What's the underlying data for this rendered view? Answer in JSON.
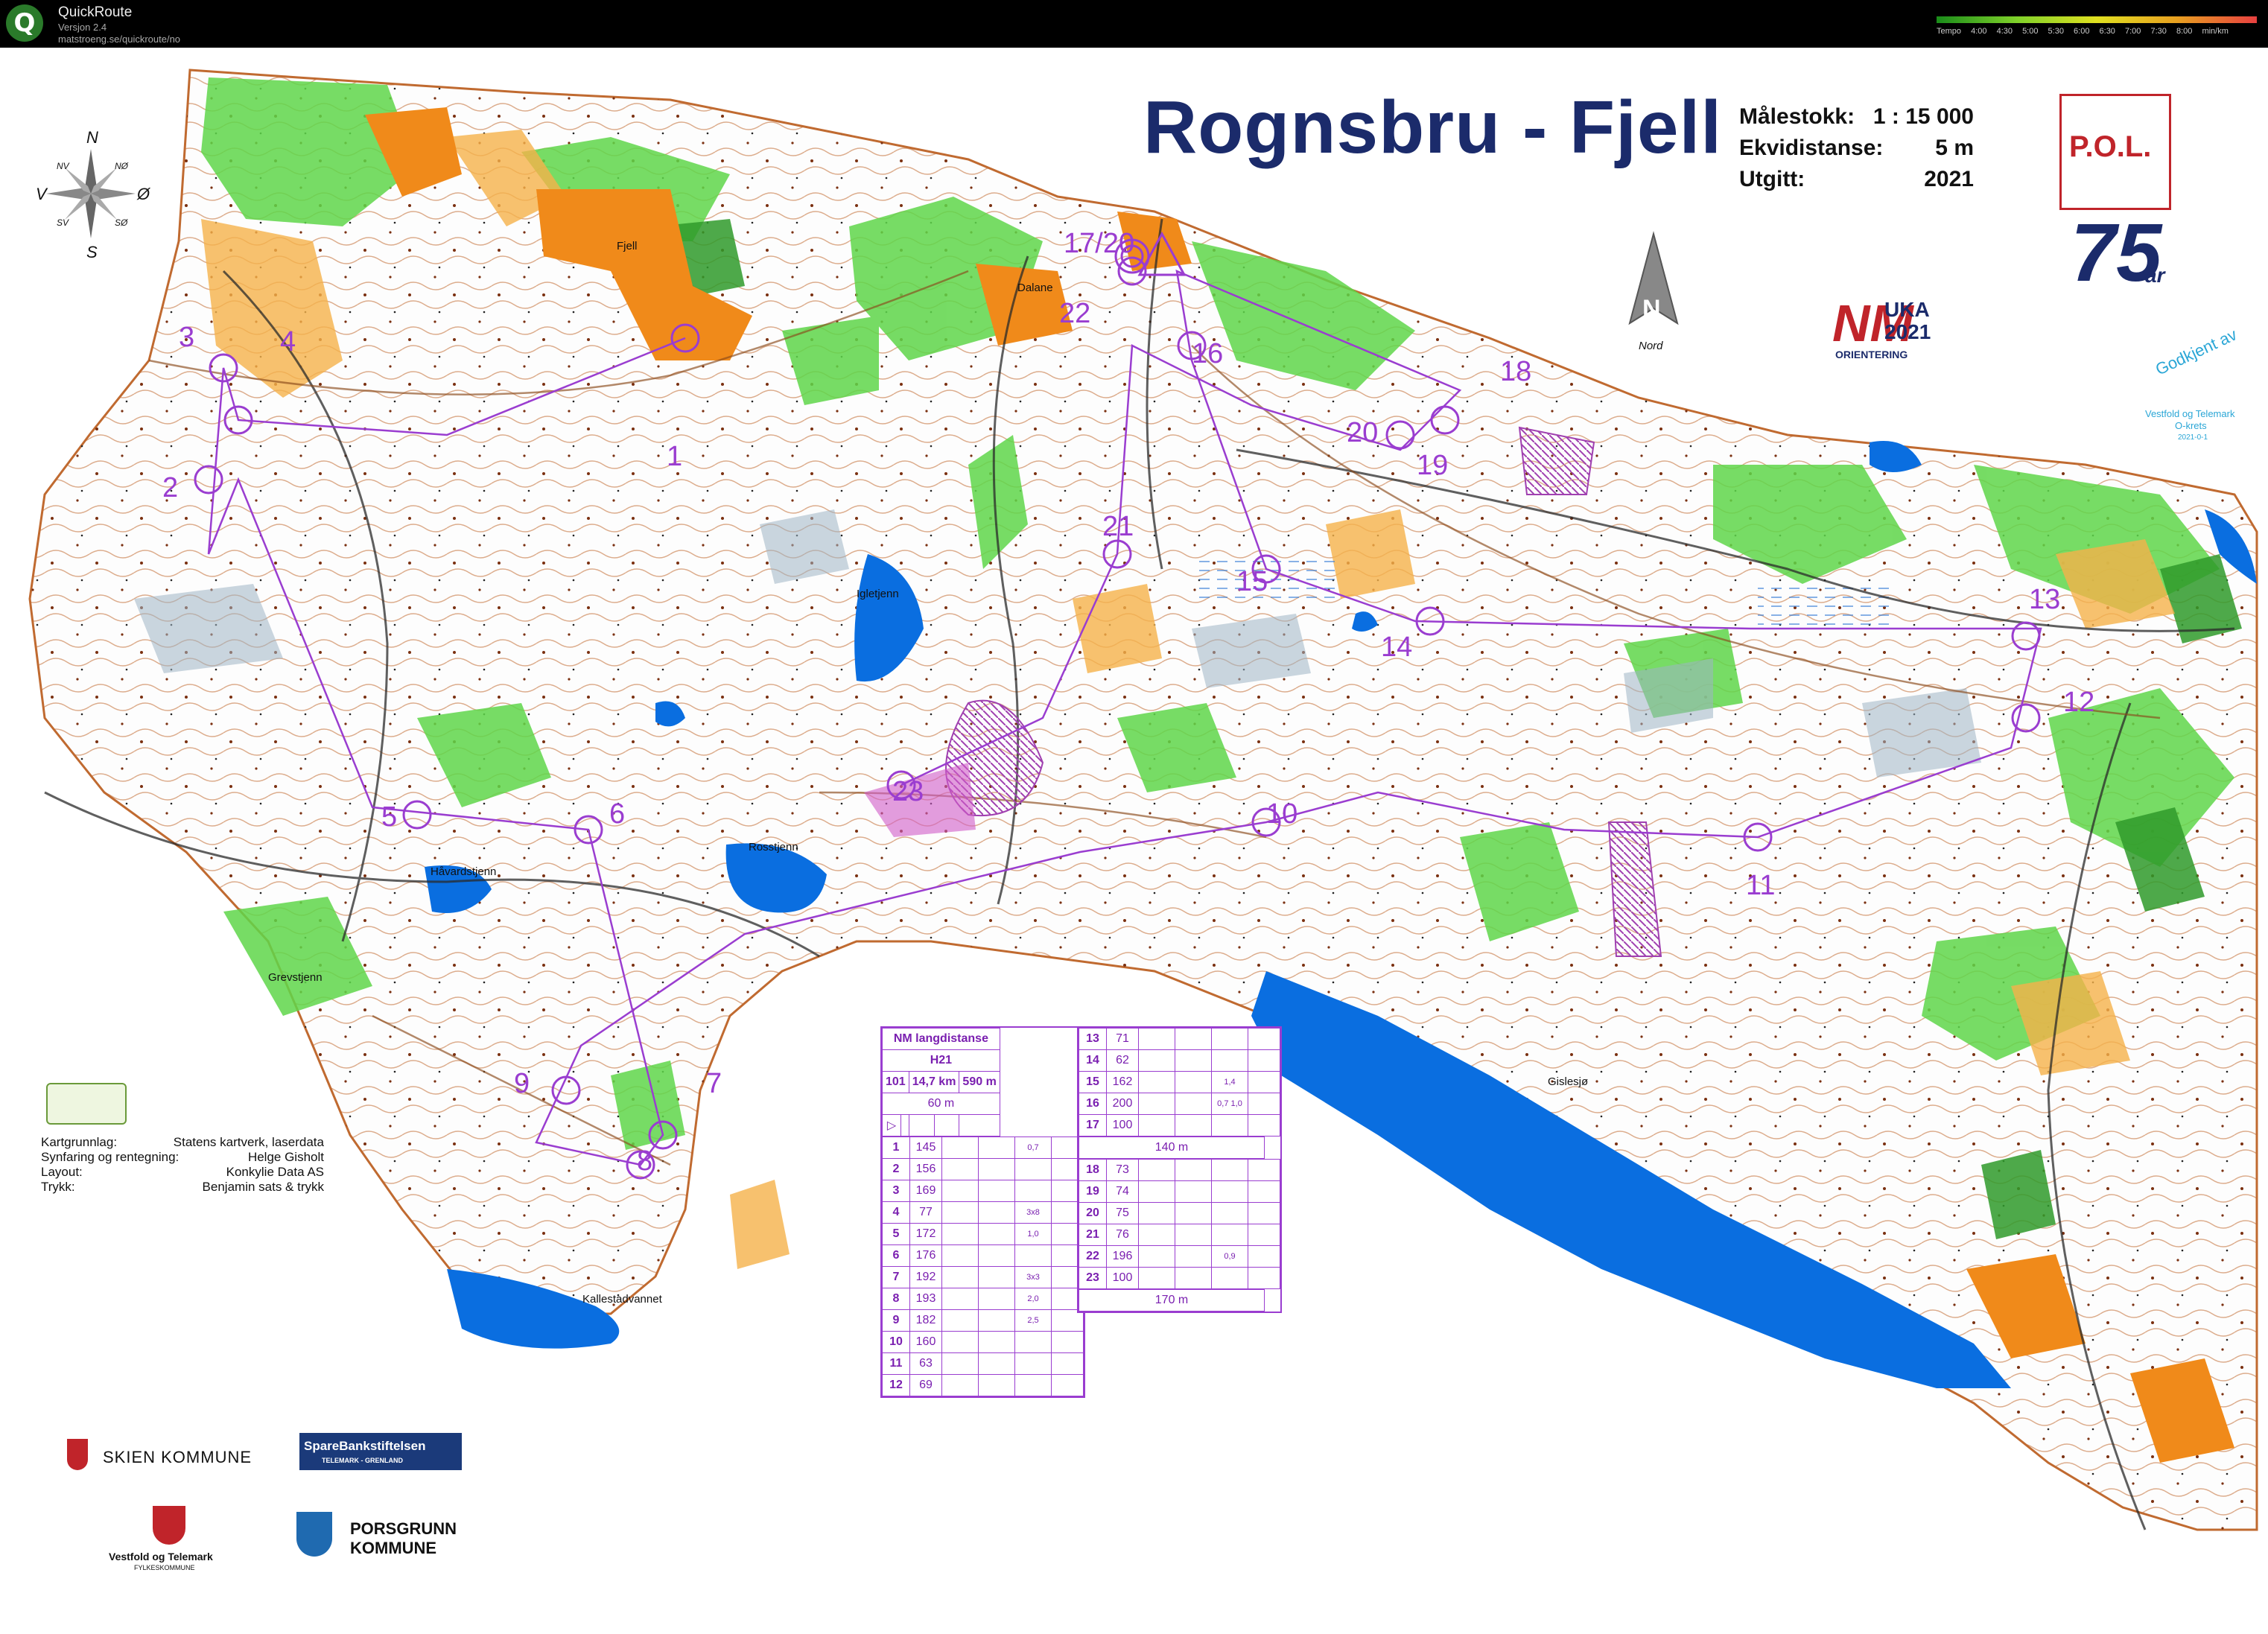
{
  "app": {
    "name": "QuickRoute",
    "version": "Versjon 2.4",
    "url": "matstroeng.se/quickroute/no",
    "tempo_label": "Tempo",
    "tempo_ticks": [
      "4:00",
      "4:30",
      "5:00",
      "5:30",
      "6:00",
      "6:30",
      "7:00",
      "7:30",
      "8:00"
    ],
    "tempo_unit": "min/km"
  },
  "map": {
    "title": "Rognsbru - Fjell",
    "scale_label": "Målestokk:",
    "scale_value": "1 : 15 000",
    "contour_label": "Ekvidistanse:",
    "contour_value": "5 m",
    "published_label": "Utgitt:",
    "published_value": "2021",
    "compass_north": "N",
    "compass_south": "S",
    "compass_west": "V",
    "compass_east": "Ø",
    "compass_nw": "NV",
    "compass_ne": "NØ",
    "compass_sw": "SV",
    "compass_se": "SØ",
    "north_arrow_letter": "N",
    "north_arrow_label": "Nord",
    "lakes": {
      "igletjenn": "Igletjenn",
      "rosstjenn": "Rosstjenn",
      "havardstjenn": "Håvardstjenn",
      "grevstjenn": "Grevstjenn",
      "kallestadvannet": "Kallestadvannet",
      "gislesjo": "Gislesjø",
      "dalane": "Dalane",
      "fjell": "Fjell"
    },
    "controls": {
      "c1": "1",
      "c2": "2",
      "c3": "3",
      "c4": "4",
      "c5": "5",
      "c6": "6",
      "c7": "7",
      "c8": "8",
      "c9": "9",
      "c10": "10",
      "c11": "11",
      "c12": "12",
      "c13": "13",
      "c14": "14",
      "c15": "15",
      "c16": "16",
      "c17_20": "17/20",
      "c18": "18",
      "c19": "19",
      "c20": "20",
      "c21": "21",
      "c22": "22",
      "c23": "23"
    },
    "credits": [
      {
        "k": "Kartgrunnlag:",
        "v": "Statens kartverk, laserdata"
      },
      {
        "k": "Synfaring og rentegning:",
        "v": "Helge Gisholt"
      },
      {
        "k": "Layout:",
        "v": "Konkylie Data AS"
      },
      {
        "k": "Trykk:",
        "v": "Benjamin sats & trykk"
      }
    ],
    "logos": {
      "pol": "P.O.L.",
      "pol_years": "75",
      "pol_ar": "år",
      "nm_uka": "NM",
      "nm_uka_sub": "UKA",
      "nm_year": "2021",
      "nm_orientering": "ORIENTERING",
      "godkjent": "Godkjent av",
      "godkjent_org1": "Vestfold og Telemark",
      "godkjent_org2": "O-krets",
      "godkjent_code": "2021-0-1",
      "skien": "SKIEN KOMMUNE",
      "sparebank": "SpareBankstiftelsen",
      "sparebank_sub": "TELEMARK - GRENLAND",
      "vestfold": "Vestfold og Telemark",
      "vestfold_sub": "FYLKESKOMMUNE",
      "porsgrunn1": "PORSGRUNN",
      "porsgrunn2": "KOMMUNE"
    }
  },
  "course": {
    "event": "NM langdistanse",
    "class": "H21",
    "course_no": "101",
    "length": "14,7 km",
    "climb": "590 m",
    "start_marking": "60 m",
    "mid_marking": "140 m",
    "finish_marking": "170 m",
    "rows_left": [
      {
        "n": "1",
        "code": "145",
        "extra": "0,7"
      },
      {
        "n": "2",
        "code": "156",
        "extra": ""
      },
      {
        "n": "3",
        "code": "169",
        "extra": ""
      },
      {
        "n": "4",
        "code": "77",
        "extra": "3x8"
      },
      {
        "n": "5",
        "code": "172",
        "extra": "1,0"
      },
      {
        "n": "6",
        "code": "176",
        "extra": ""
      },
      {
        "n": "7",
        "code": "192",
        "extra": "3x3"
      },
      {
        "n": "8",
        "code": "193",
        "extra": "2,0"
      },
      {
        "n": "9",
        "code": "182",
        "extra": "2,5"
      },
      {
        "n": "10",
        "code": "160",
        "extra": ""
      },
      {
        "n": "11",
        "code": "63",
        "extra": ""
      },
      {
        "n": "12",
        "code": "69",
        "extra": ""
      }
    ],
    "rows_right_a": [
      {
        "n": "13",
        "code": "71",
        "extra": ""
      },
      {
        "n": "14",
        "code": "62",
        "extra": ""
      },
      {
        "n": "15",
        "code": "162",
        "extra": "1,4"
      },
      {
        "n": "16",
        "code": "200",
        "extra": "0,7 1,0"
      },
      {
        "n": "17",
        "code": "100",
        "extra": ""
      }
    ],
    "rows_right_b": [
      {
        "n": "18",
        "code": "73",
        "extra": ""
      },
      {
        "n": "19",
        "code": "74",
        "extra": ""
      },
      {
        "n": "20",
        "code": "75",
        "extra": ""
      },
      {
        "n": "21",
        "code": "76",
        "extra": ""
      },
      {
        "n": "22",
        "code": "196",
        "extra": "0,9"
      },
      {
        "n": "23",
        "code": "100",
        "extra": ""
      }
    ]
  },
  "colors": {
    "course": "#9a3dd0",
    "title": "#1b2b6b",
    "water": "#0a6ee0",
    "forest_green": "#3fcf3f",
    "open_yellow": "#f5b24a",
    "settlement": "#f08a1a",
    "contour": "#b5571e"
  }
}
